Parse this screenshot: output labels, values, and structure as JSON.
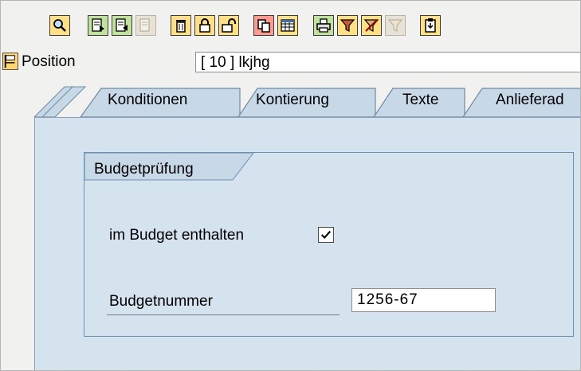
{
  "toolbar": {
    "buttons": [
      {
        "icon": "magnifier-icon"
      },
      {
        "icon": "document-next-icon"
      },
      {
        "icon": "document-previous-icon"
      },
      {
        "icon": "document-disabled-icon"
      },
      {
        "icon": "trash-icon"
      },
      {
        "icon": "lock-closed-icon"
      },
      {
        "icon": "lock-open-icon"
      },
      {
        "icon": "copy-icon"
      },
      {
        "icon": "grid-icon"
      },
      {
        "icon": "printer-icon"
      },
      {
        "icon": "filter-icon"
      },
      {
        "icon": "filter-remove-icon"
      },
      {
        "icon": "filter-disabled-icon"
      },
      {
        "icon": "clipboard-icon"
      }
    ]
  },
  "position": {
    "label": "Position",
    "value": "[ 10 ] lkjhg"
  },
  "tabs": [
    {
      "label": "Konditionen"
    },
    {
      "label": "Kontierung"
    },
    {
      "label": "Texte"
    },
    {
      "label": "Anlieferad"
    }
  ],
  "group": {
    "title": "Budgetprüfung",
    "checkbox_label": "im Budget enthalten",
    "checkbox_checked": true,
    "budget_label": "Budgetnummer",
    "budget_value": "1256-67"
  }
}
